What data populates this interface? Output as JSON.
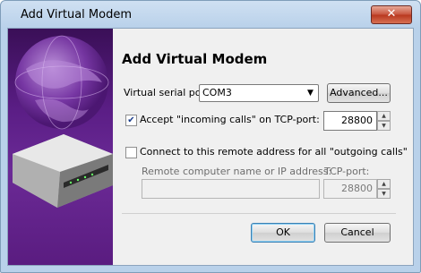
{
  "window": {
    "title": "Add Virtual Modem",
    "close_label": "✕"
  },
  "heading": "Add Virtual Modem",
  "serial_port": {
    "label": "Virtual serial port:",
    "value": "COM3",
    "advanced_label": "Advanced..."
  },
  "incoming": {
    "checked": true,
    "label": "Accept \"incoming calls\" on TCP-port:",
    "port": "28800"
  },
  "outgoing": {
    "checked": false,
    "label": "Connect to this remote address for all \"outgoing calls\"",
    "remote_label": "Remote computer name or IP address:",
    "remote_value": "",
    "tcp_label": "TCP-port:",
    "port": "28800"
  },
  "buttons": {
    "ok": "OK",
    "cancel": "Cancel"
  },
  "colors": {
    "accent": "#3c7fb1",
    "sidebar": "#5b1e86"
  }
}
